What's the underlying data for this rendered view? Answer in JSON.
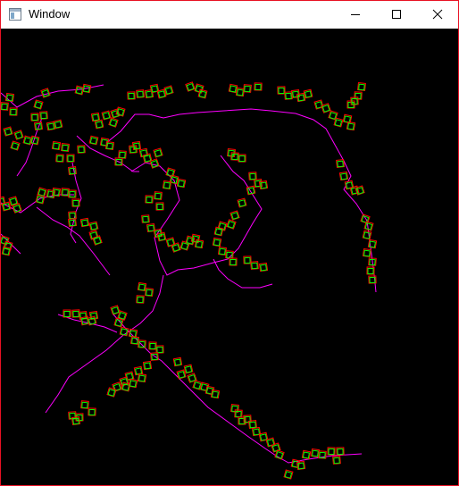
{
  "window": {
    "title": "Window",
    "icon": "app-window-icon",
    "controls": [
      {
        "name": "minimize-icon"
      },
      {
        "name": "maximize-icon"
      },
      {
        "name": "close-icon"
      }
    ],
    "frame_color": "#e81123",
    "canvas_bg": "#000000",
    "path_color": "#ff00ff",
    "box_outer_color": "#ff0000",
    "box_inner_color": "#00ff00"
  }
}
